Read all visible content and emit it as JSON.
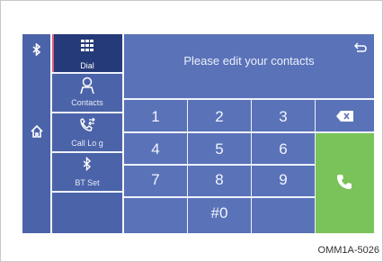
{
  "sidebar_left": {
    "icons": [
      "bluetooth-icon",
      "home-icon"
    ]
  },
  "menu": {
    "items": [
      {
        "label": "Dial",
        "icon": "keypad-icon",
        "active": true
      },
      {
        "label": "Contacts",
        "icon": "person-icon",
        "active": false
      },
      {
        "label": "Call Lo g",
        "icon": "call-log-icon",
        "active": false
      },
      {
        "label": "BT Set",
        "icon": "bluetooth-icon",
        "active": false
      }
    ]
  },
  "main": {
    "prompt": "Please edit your contacts",
    "keys": [
      "1",
      "2",
      "3",
      "4",
      "5",
      "6",
      "7",
      "8",
      "9",
      "#0"
    ],
    "delete_icon": "backspace-icon",
    "call_icon": "phone-icon",
    "back_icon": "back-arrow-icon"
  },
  "caption": "OMM1A-5026",
  "colors": {
    "panel": "#4b63a8",
    "active": "#253a78",
    "keypad": "#5a72b8",
    "call": "#7ac25a"
  }
}
